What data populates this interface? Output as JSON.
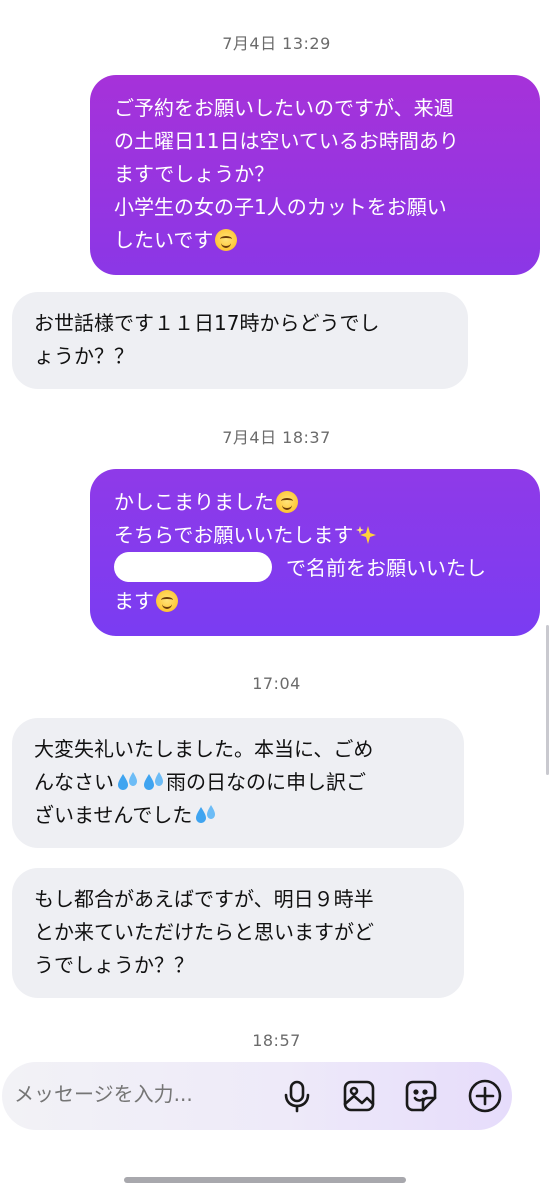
{
  "conversation": {
    "timestamps": [
      "7月4日 13:29",
      "7月4日 18:37",
      "17:04",
      "18:57"
    ],
    "messages": [
      {
        "direction": "outgoing",
        "lines": [
          "ご予約をお願いしたいのですが、来週",
          "の土曜日11日は空いているお時間あり",
          "ますでしょうか？",
          "小学生の女の子1人のカットをお願い",
          "したいです"
        ]
      },
      {
        "direction": "incoming",
        "lines": [
          "お世話様です１１日17時からどうでし",
          "ょうか？？"
        ]
      },
      {
        "direction": "outgoing",
        "lines": [
          "かしこまりました",
          "そちらでお願いいたします",
          "で名前をお願いいたし",
          "ます"
        ]
      },
      {
        "direction": "incoming",
        "lines": [
          "大変失礼いたしました。本当に、ごめ",
          "んなさい",
          "雨の日なのに申し訳ご",
          "ざいませんでした"
        ]
      },
      {
        "direction": "incoming",
        "lines": [
          "もし都合があえばですが、明日９時半",
          "とか来ていただけたらと思いますがど",
          "うでしょうか？？"
        ]
      }
    ]
  },
  "composer": {
    "placeholder": "メッセージを入力...",
    "icons": [
      "microphone-icon",
      "image-icon",
      "sticker-icon",
      "add-icon"
    ]
  },
  "colors": {
    "outgoing_gradient_start": "#a632d9",
    "outgoing_gradient_end": "#7a3cf2",
    "incoming_bubble": "#eeeff3",
    "timestamp_text": "#6b6b6b"
  },
  "emoji": {
    "smile": "smiling-face-icon",
    "sparkles": "sparkles-icon",
    "sweat": "sweat-droplets-icon"
  }
}
